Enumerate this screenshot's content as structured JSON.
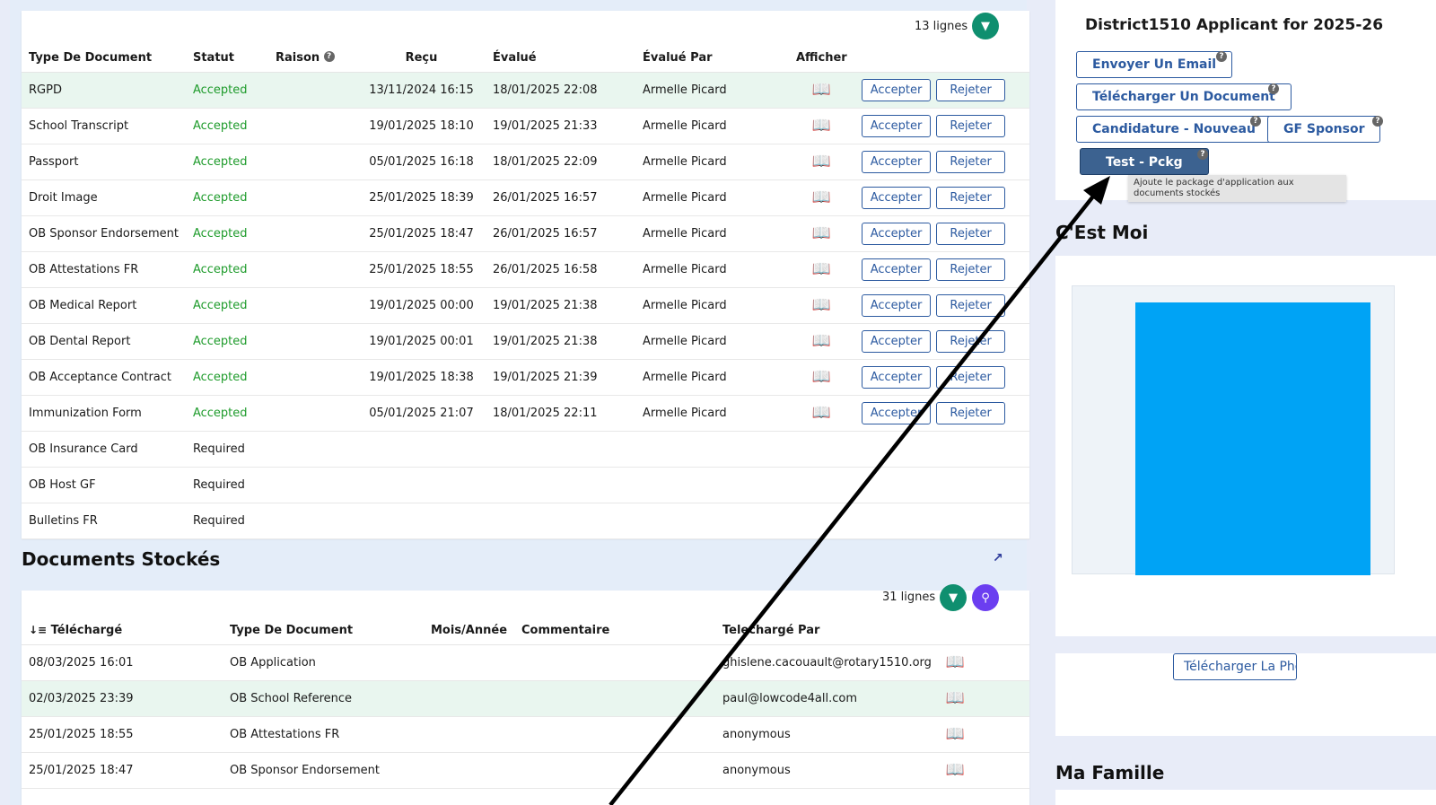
{
  "documents": {
    "row_count": "13 lignes",
    "columns": [
      "Type De Document",
      "Statut",
      "Raison",
      "Reçu",
      "Évalué",
      "Évalué Par",
      "Afficher"
    ],
    "accept_label": "Accepter",
    "reject_label": "Rejeter",
    "rows": [
      {
        "type": "RGPD",
        "status": "Accepted",
        "received": "13/11/2024 16:15",
        "evaluated": "18/01/2025 22:08",
        "by": "Armelle Picard"
      },
      {
        "type": "School Transcript",
        "status": "Accepted",
        "received": "19/01/2025 18:10",
        "evaluated": "19/01/2025 21:33",
        "by": "Armelle Picard"
      },
      {
        "type": "Passport",
        "status": "Accepted",
        "received": "05/01/2025 16:18",
        "evaluated": "18/01/2025 22:09",
        "by": "Armelle Picard"
      },
      {
        "type": "Droit Image",
        "status": "Accepted",
        "received": "25/01/2025 18:39",
        "evaluated": "26/01/2025 16:57",
        "by": "Armelle Picard"
      },
      {
        "type": "OB Sponsor Endorsement",
        "status": "Accepted",
        "received": "25/01/2025 18:47",
        "evaluated": "26/01/2025 16:57",
        "by": "Armelle Picard"
      },
      {
        "type": "OB Attestations FR",
        "status": "Accepted",
        "received": "25/01/2025 18:55",
        "evaluated": "26/01/2025 16:58",
        "by": "Armelle Picard"
      },
      {
        "type": "OB Medical Report",
        "status": "Accepted",
        "received": "19/01/2025 00:00",
        "evaluated": "19/01/2025 21:38",
        "by": "Armelle Picard"
      },
      {
        "type": "OB Dental Report",
        "status": "Accepted",
        "received": "19/01/2025 00:01",
        "evaluated": "19/01/2025 21:38",
        "by": "Armelle Picard"
      },
      {
        "type": "OB Acceptance Contract",
        "status": "Accepted",
        "received": "19/01/2025 18:38",
        "evaluated": "19/01/2025 21:39",
        "by": "Armelle Picard"
      },
      {
        "type": "Immunization Form",
        "status": "Accepted",
        "received": "05/01/2025 21:07",
        "evaluated": "18/01/2025 22:11",
        "by": "Armelle Picard"
      },
      {
        "type": "OB Insurance Card",
        "status": "Required"
      },
      {
        "type": "OB Host GF",
        "status": "Required"
      },
      {
        "type": "Bulletins FR",
        "status": "Required"
      }
    ]
  },
  "stored": {
    "title": "Documents Stockés",
    "row_count": "31 lignes",
    "columns": [
      "Téléchargé",
      "Type De Document",
      "Mois/Année",
      "Commentaire",
      "Telechargé Par"
    ],
    "rows": [
      {
        "date": "08/03/2025 16:01",
        "type": "OB Application",
        "by": "ghislene.cacouault@rotary1510.org"
      },
      {
        "date": "02/03/2025 23:39",
        "type": "OB School Reference",
        "by": "paul@lowcode4all.com"
      },
      {
        "date": "25/01/2025 18:55",
        "type": "OB Attestations FR",
        "by": "anonymous"
      },
      {
        "date": "25/01/2025 18:47",
        "type": "OB Sponsor Endorsement",
        "by": "anonymous"
      }
    ]
  },
  "applicant": {
    "title": "District1510 Applicant for 2025-26",
    "send_email": "Envoyer Un Email",
    "upload_doc": "Télécharger Un Document",
    "new_application": "Candidature - Nouveau",
    "gf_sponsor": "GF Sponsor",
    "test_pckg": "Test - Pckg",
    "tooltip": "Ajoute le package d'application aux documents stockés"
  },
  "cest_moi": {
    "title": "C'Est Moi",
    "photo_color": "#00a3f5",
    "upload_photo": "Télécharger La Pho"
  },
  "famille": {
    "title": "Ma Famille"
  },
  "colors": {
    "accent": "#2c5aa0",
    "accepted": "#1e9b2b",
    "filter": "#0f8f6f",
    "search": "#6b3ef0",
    "primary_button": "#3c6290"
  }
}
